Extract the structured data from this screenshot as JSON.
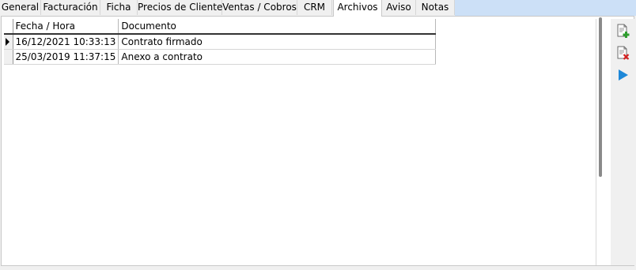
{
  "tabs": [
    {
      "label": "General",
      "active": false
    },
    {
      "label": "Facturación",
      "active": false
    },
    {
      "label": "Ficha",
      "active": false
    },
    {
      "label": "Precios de Cliente",
      "active": false
    },
    {
      "label": "Ventas / Cobros",
      "active": false
    },
    {
      "label": "CRM",
      "active": false
    },
    {
      "label": "Archivos",
      "active": true
    },
    {
      "label": "Aviso",
      "active": false
    },
    {
      "label": "Notas",
      "active": false
    }
  ],
  "grid": {
    "columns": [
      "Fecha / Hora",
      "Documento"
    ],
    "rows": [
      {
        "datetime": "16/12/2021 10:33:13",
        "document": "Contrato firmado",
        "selected": true
      },
      {
        "datetime": "25/03/2019 11:37:15",
        "document": "Anexo a contrato",
        "selected": false
      }
    ]
  },
  "toolbar": {
    "buttons": [
      {
        "icon": "add-document-icon"
      },
      {
        "icon": "delete-document-icon"
      },
      {
        "icon": "play-icon"
      }
    ]
  },
  "colors": {
    "tabstrip_bg": "#cce0f7",
    "add_green": "#2e9e2e",
    "delete_red": "#d42020",
    "play_blue": "#1e88d8"
  }
}
